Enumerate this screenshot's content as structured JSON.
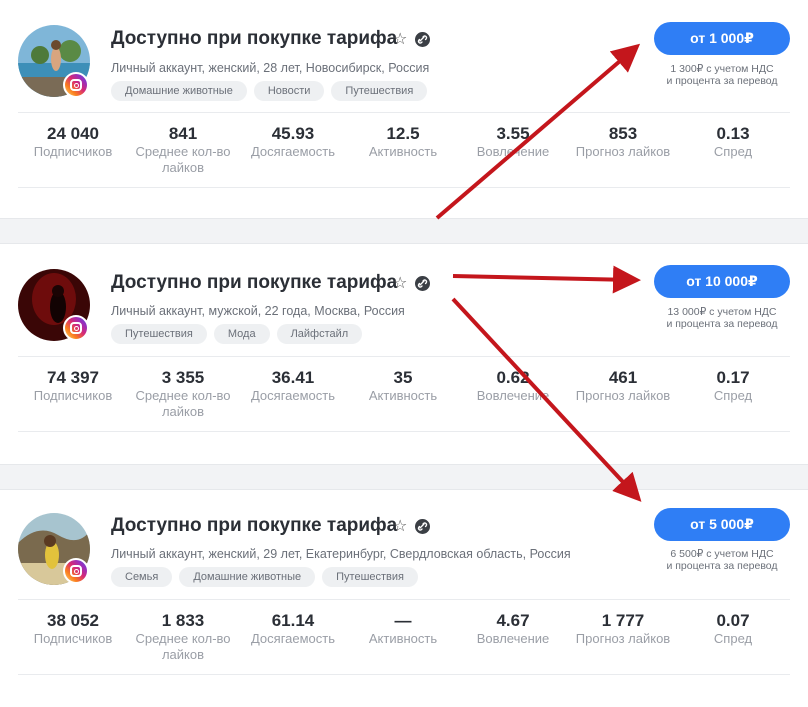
{
  "cards": [
    {
      "title": "Доступно при покупке тарифа",
      "subtitle": "Личный аккаунт, женский, 28 лет, Новосибирск, Россия",
      "tags": [
        "Домашние животные",
        "Новости",
        "Путешествия"
      ],
      "price": "от 1 000₽",
      "note_line1": "1 300₽ с учетом НДС",
      "note_line2": "и процента за перевод",
      "stats": [
        {
          "value": "24 040",
          "label": "Подписчиков"
        },
        {
          "value": "841",
          "label": "Среднее кол-во лайков"
        },
        {
          "value": "45.93",
          "label": "Досягаемость"
        },
        {
          "value": "12.5",
          "label": "Активность"
        },
        {
          "value": "3.55",
          "label": "Вовлечение"
        },
        {
          "value": "853",
          "label": "Прогноз лайков"
        },
        {
          "value": "0.13",
          "label": "Спред"
        }
      ]
    },
    {
      "title": "Доступно при покупке тарифа",
      "subtitle": "Личный аккаунт, мужской, 22 года, Москва, Россия",
      "tags": [
        "Путешествия",
        "Мода",
        "Лайфстайл"
      ],
      "price": "от 10 000₽",
      "note_line1": "13 000₽ с учетом НДС",
      "note_line2": "и процента за перевод",
      "stats": [
        {
          "value": "74 397",
          "label": "Подписчиков"
        },
        {
          "value": "3 355",
          "label": "Среднее кол-во лайков"
        },
        {
          "value": "36.41",
          "label": "Досягаемость"
        },
        {
          "value": "35",
          "label": "Активность"
        },
        {
          "value": "0.62",
          "label": "Вовлечение"
        },
        {
          "value": "461",
          "label": "Прогноз лайков"
        },
        {
          "value": "0.17",
          "label": "Спред"
        }
      ]
    },
    {
      "title": "Доступно при покупке тарифа",
      "subtitle": "Личный аккаунт, женский, 29 лет, Екатеринбург, Свердловская область, Россия",
      "tags": [
        "Семья",
        "Домашние животные",
        "Путешествия"
      ],
      "price": "от 5 000₽",
      "note_line1": "6 500₽ с учетом НДС",
      "note_line2": "и процента за перевод",
      "stats": [
        {
          "value": "38 052",
          "label": "Подписчиков"
        },
        {
          "value": "1 833",
          "label": "Среднее кол-во лайков"
        },
        {
          "value": "61.14",
          "label": "Досягаемость"
        },
        {
          "value": "—",
          "label": "Активность"
        },
        {
          "value": "4.67",
          "label": "Вовлечение"
        },
        {
          "value": "1 777",
          "label": "Прогноз лайков"
        },
        {
          "value": "0.07",
          "label": "Спред"
        }
      ]
    }
  ],
  "colors": {
    "accent": "#2f7ef5",
    "arrow": "#c4161c",
    "muted": "#9a9ea6",
    "separator": "#f2f3f5"
  },
  "icons": [
    "star-icon",
    "link-icon",
    "instagram-icon",
    "avatar-photo"
  ]
}
